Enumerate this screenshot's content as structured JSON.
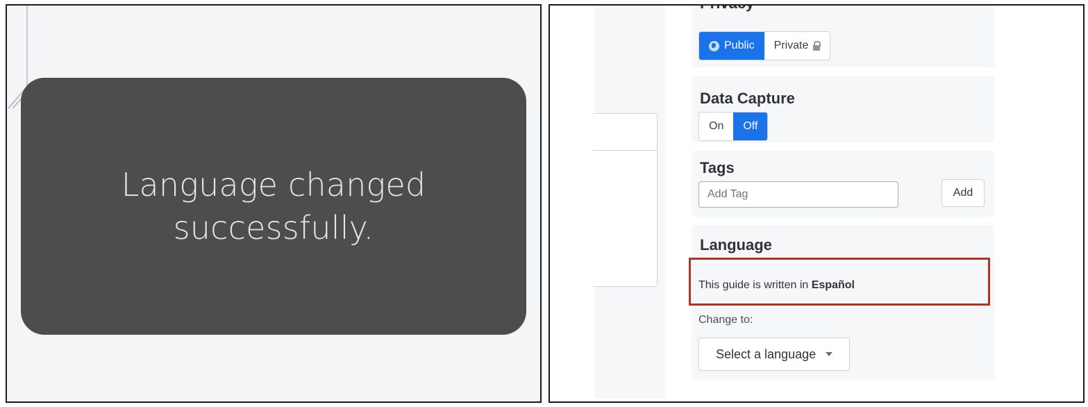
{
  "toast": {
    "message": "Language changed successfully."
  },
  "sidebar": {
    "privacy": {
      "title": "Privacy",
      "options": [
        "Public",
        "Private"
      ],
      "selected": "Public"
    },
    "data_capture": {
      "title": "Data Capture",
      "options": [
        "On",
        "Off"
      ],
      "selected": "Off"
    },
    "tags": {
      "title": "Tags",
      "input_placeholder": "Add Tag",
      "input_value": "",
      "add_label": "Add"
    },
    "language": {
      "title": "Language",
      "written_in_prefix": "This guide is written in ",
      "current_language": "Español",
      "change_to_label": "Change to:",
      "select_value": "Select a language"
    }
  },
  "colors": {
    "accent": "#1a73e8",
    "toast_bg": "#4d4d4d",
    "highlight_border": "#b5321f"
  },
  "icons": {
    "public": "globe-icon",
    "private": "lock-icon",
    "select": "chevron-down-icon"
  }
}
